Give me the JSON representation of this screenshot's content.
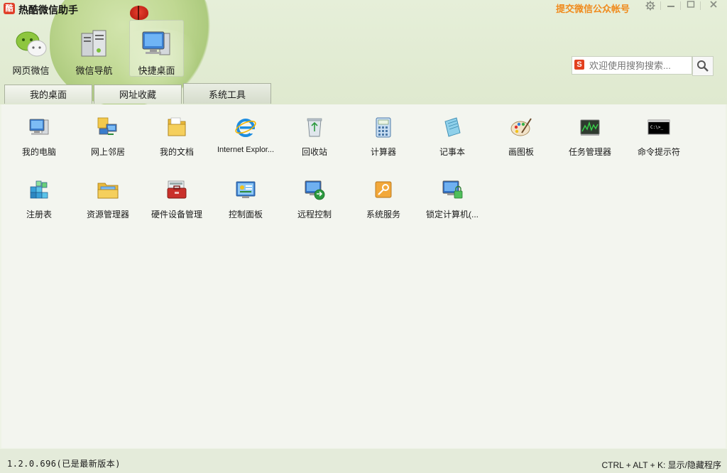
{
  "app": {
    "title": "热酷微信助手",
    "logo_char": "酷",
    "submit_link": "提交微信公众帐号"
  },
  "window_controls": {
    "settings_icon": "gear-icon",
    "minimize_icon": "minimize-icon",
    "maximize_icon": "maximize-icon",
    "close_icon": "close-icon"
  },
  "nav": [
    {
      "label": "网页微信",
      "icon": "wechat-icon"
    },
    {
      "label": "微信导航",
      "icon": "server-navigation-icon"
    },
    {
      "label": "快捷桌面",
      "icon": "desktop-computer-icon",
      "active": true
    }
  ],
  "search": {
    "placeholder": "欢迎使用搜狗搜索...",
    "engine_icon": "sogou-icon",
    "button_icon": "magnifier-icon"
  },
  "tabs": [
    {
      "label": "我的桌面"
    },
    {
      "label": "网址收藏"
    },
    {
      "label": "系统工具",
      "active": true
    }
  ],
  "tools": [
    {
      "label": "我的电脑",
      "icon": "my-computer-icon"
    },
    {
      "label": "网上邻居",
      "icon": "network-neighborhood-icon"
    },
    {
      "label": "我的文档",
      "icon": "my-documents-icon"
    },
    {
      "label": "Internet Explor...",
      "icon": "internet-explorer-icon"
    },
    {
      "label": "回收站",
      "icon": "recycle-bin-icon"
    },
    {
      "label": "计算器",
      "icon": "calculator-icon"
    },
    {
      "label": "记事本",
      "icon": "notepad-icon"
    },
    {
      "label": "画图板",
      "icon": "paint-palette-icon"
    },
    {
      "label": "任务管理器",
      "icon": "task-manager-icon"
    },
    {
      "label": "命令提示符",
      "icon": "command-prompt-icon"
    },
    {
      "label": "注册表",
      "icon": "registry-icon"
    },
    {
      "label": "资源管理器",
      "icon": "explorer-folder-icon"
    },
    {
      "label": "硬件设备管理",
      "icon": "device-manager-icon"
    },
    {
      "label": "控制面板",
      "icon": "control-panel-icon"
    },
    {
      "label": "远程控制",
      "icon": "remote-desktop-icon"
    },
    {
      "label": "系统服务",
      "icon": "system-services-icon"
    },
    {
      "label": "锁定计算机(...",
      "icon": "lock-computer-icon"
    }
  ],
  "status": {
    "version": "1.2.0.696(已是最新版本)",
    "hotkey": "CTRL + ALT + K: 显示/隐藏程序"
  },
  "colors": {
    "accent_orange": "#f08a1c",
    "header_green": "#dfe9cf",
    "content_bg": "#f3f5ef"
  }
}
